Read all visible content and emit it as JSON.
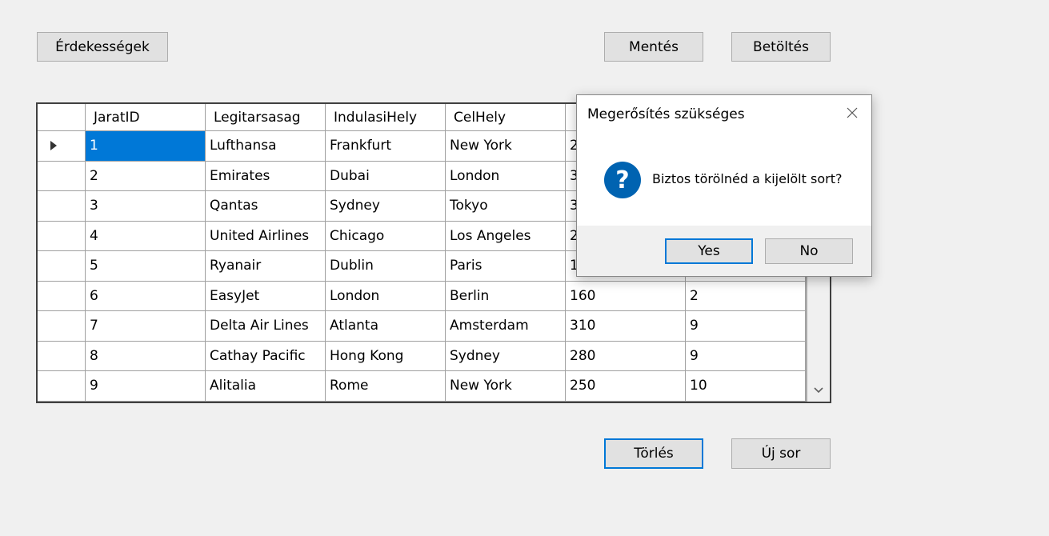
{
  "toolbar": {
    "interests_label": "Érdekességek",
    "save_label": "Mentés",
    "load_label": "Betöltés"
  },
  "grid": {
    "columns": [
      "JaratID",
      "Legitarsasag",
      "IndulasiHely",
      "CelHely",
      "",
      ""
    ],
    "rows": [
      [
        "1",
        "Lufthansa",
        "Frankfurt",
        "New York",
        "2",
        ""
      ],
      [
        "2",
        "Emirates",
        "Dubai",
        "London",
        "3",
        ""
      ],
      [
        "3",
        "Qantas",
        "Sydney",
        "Tokyo",
        "3",
        ""
      ],
      [
        "4",
        "United Airlines",
        "Chicago",
        "Los Angeles",
        "2",
        ""
      ],
      [
        "5",
        "Ryanair",
        "Dublin",
        "Paris",
        "1",
        ""
      ],
      [
        "6",
        "EasyJet",
        "London",
        "Berlin",
        "160",
        "2"
      ],
      [
        "7",
        "Delta Air Lines",
        "Atlanta",
        "Amsterdam",
        "310",
        "9"
      ],
      [
        "8",
        "Cathay Pacific",
        "Hong Kong",
        "Sydney",
        "280",
        "9"
      ],
      [
        "9",
        "Alitalia",
        "Rome",
        "New York",
        "250",
        "10"
      ]
    ],
    "selected_row": 0,
    "scroll_icon": "chevron-down-icon",
    "selection_color": "#0078d7"
  },
  "actions": {
    "delete_label": "Törlés",
    "new_row_label": "Új sor"
  },
  "dialog": {
    "title": "Megerősítés szükséges",
    "message": "Biztos törölnéd a kijelölt sort?",
    "icon": "question-icon",
    "yes_label": "Yes",
    "no_label": "No"
  }
}
